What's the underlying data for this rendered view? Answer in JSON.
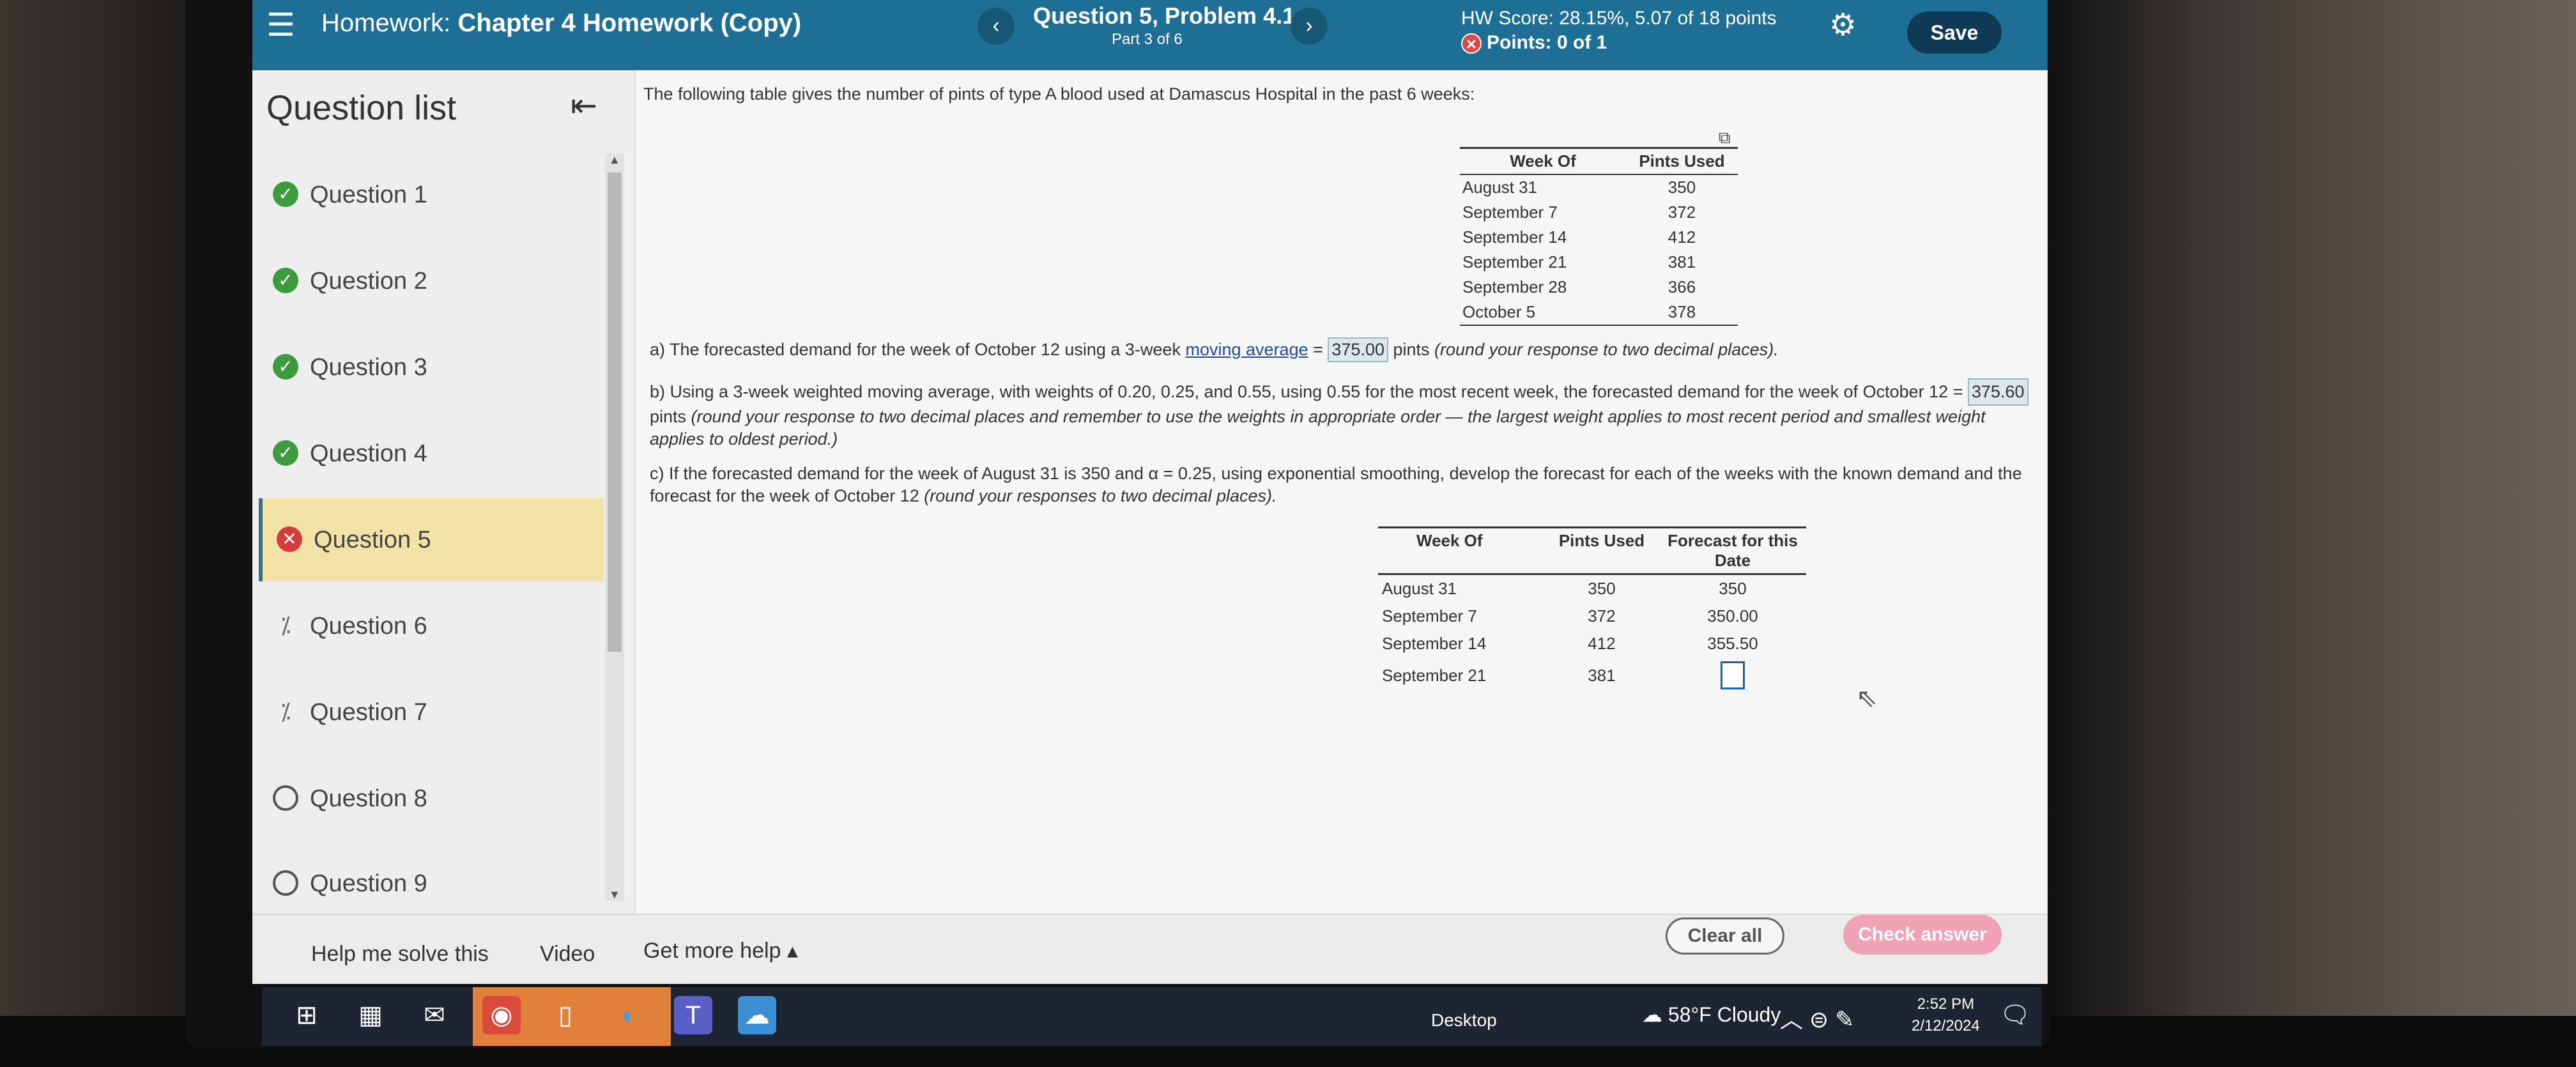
{
  "header": {
    "menu_icon": "hamburger-icon",
    "hw_prefix": "Homework:",
    "hw_name": "Chapter 4 Homework (Copy)",
    "question_title": "Question 5, Problem 4.1",
    "question_part": "Part 3 of 6",
    "hw_score": "HW Score: 28.15%, 5.07 of 18 points",
    "points": "Points: 0 of 1",
    "save_label": "Save",
    "accent": "#1e6f96"
  },
  "sidebar": {
    "title": "Question list",
    "items": [
      {
        "label": "Question 1",
        "status": "correct"
      },
      {
        "label": "Question 2",
        "status": "correct"
      },
      {
        "label": "Question 3",
        "status": "correct"
      },
      {
        "label": "Question 4",
        "status": "correct"
      },
      {
        "label": "Question 5",
        "status": "incorrect"
      },
      {
        "label": "Question 6",
        "status": "partial"
      },
      {
        "label": "Question 7",
        "status": "partial"
      },
      {
        "label": "Question 8",
        "status": "unanswered"
      },
      {
        "label": "Question 9",
        "status": "unanswered"
      }
    ]
  },
  "problem": {
    "intro": "The following table gives the number of pints of type A blood used at Damascus Hospital in the past 6 weeks:",
    "table1": {
      "headers": [
        "Week Of",
        "Pints Used"
      ],
      "rows": [
        [
          "August 31",
          "350"
        ],
        [
          "September 7",
          "372"
        ],
        [
          "September 14",
          "412"
        ],
        [
          "September 21",
          "381"
        ],
        [
          "September 28",
          "366"
        ],
        [
          "October 5",
          "378"
        ]
      ]
    },
    "part_a": {
      "prefix": "a) The forecasted demand for the week of October 12 using a 3-week ",
      "link": "moving average",
      "equals": " = ",
      "answer": "375.00",
      "suffix": " pints ",
      "hint": "(round your response to two decimal places)."
    },
    "part_b": {
      "text": "b) Using a 3-week weighted moving average, with weights of 0.20, 0.25, and 0.55, using 0.55 for the most recent week, the forecasted demand for the week of October 12 = ",
      "answer": "375.60",
      "suffix": " pints ",
      "hint": "(round your response to two decimal places and remember to use the weights in appropriate order — the largest weight applies to most recent period and smallest weight applies to oldest period.)"
    },
    "part_c": {
      "text": "c) If the forecasted demand for the week of August 31 is 350 and α = 0.25, using exponential smoothing, develop the forecast for each of the weeks with the known demand and the forecast for the week of October 12 ",
      "hint": "(round your responses to two decimal places)."
    },
    "table2": {
      "headers": [
        "Week Of",
        "Pints Used",
        "Forecast for this Date"
      ],
      "rows": [
        [
          "August 31",
          "350",
          "350"
        ],
        [
          "September 7",
          "372",
          "350.00"
        ],
        [
          "September 14",
          "412",
          "355.50"
        ],
        [
          "September 21",
          "381",
          ""
        ]
      ]
    }
  },
  "footer": {
    "help": "Help me solve this",
    "video": "Video",
    "more_help": "Get more help ▴",
    "clear_all": "Clear all",
    "check_answer": "Check answer"
  },
  "taskbar": {
    "desktop": "Desktop",
    "weather": "58°F  Cloudy",
    "time": "2:52 PM",
    "date": "2/12/2024"
  }
}
